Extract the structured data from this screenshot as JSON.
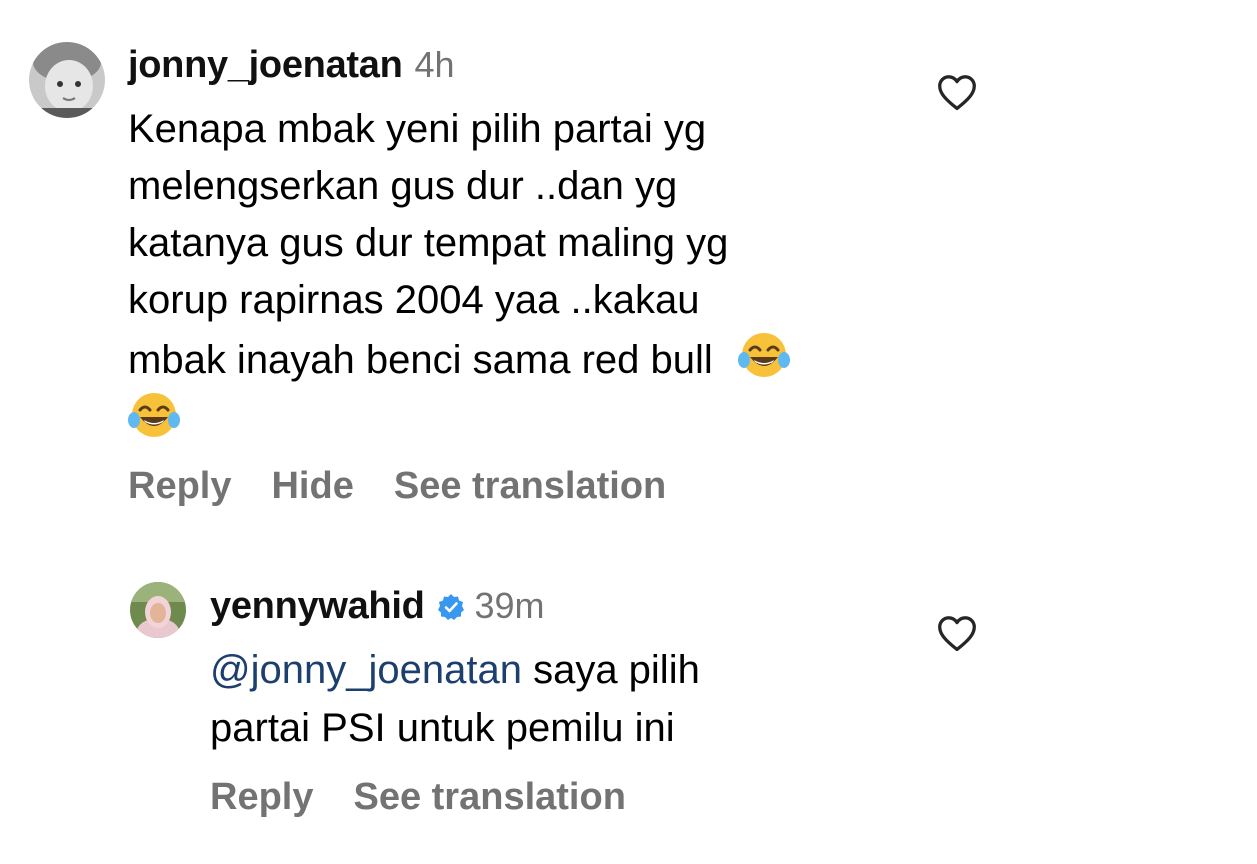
{
  "comments": [
    {
      "username": "jonny_joenatan",
      "time": "4h",
      "text_lines": [
        "Kenapa mbak yeni pilih partai yg",
        "melengserkan gus dur ..dan yg",
        "katanya gus dur tempat maling yg",
        "korup rapirnas 2004 yaa ..kakau",
        "mbak inayah benci sama red bull"
      ],
      "emoji": "face-with-tears-of-joy",
      "actions": {
        "reply": "Reply",
        "hide": "Hide",
        "translate": "See translation"
      }
    }
  ],
  "reply": {
    "username": "yennywahid",
    "verified": true,
    "time": "39m",
    "mention": "@jonny_joenatan",
    "text_first_line_rest": " saya pilih",
    "text_second_line": "partai PSI untuk pemilu ini",
    "actions": {
      "reply": "Reply",
      "translate": "See translation"
    }
  },
  "colors": {
    "secondary_text": "#737373",
    "mention": "#1d3f6e",
    "verified_badge": "#3897f0"
  },
  "icons": [
    "heart-outline-icon",
    "verified-badge-icon",
    "face-with-tears-of-joy-emoji"
  ]
}
